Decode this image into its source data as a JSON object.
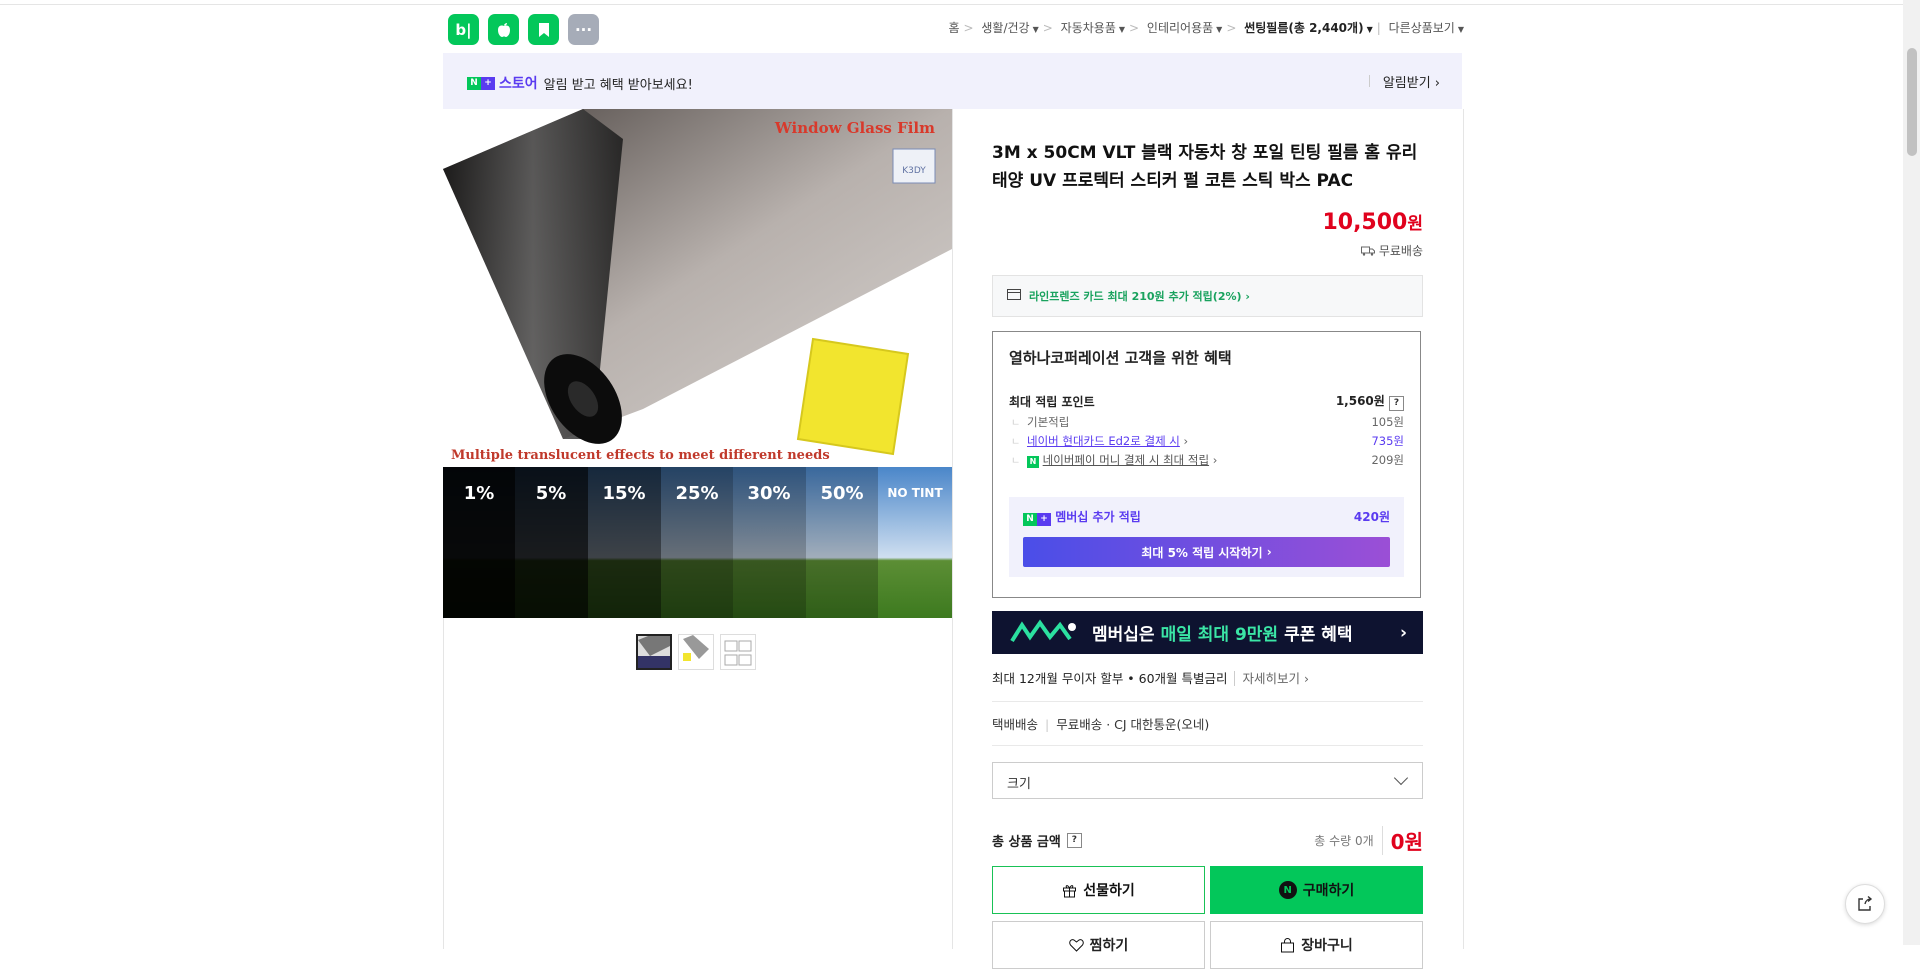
{
  "header": {
    "apps": [
      {
        "label": "b|",
        "icon": "blog-icon",
        "color": "#03c75a"
      },
      {
        "label": "",
        "icon": "apple-icon",
        "color": "#03c75a"
      },
      {
        "label": "",
        "icon": "bookmark-icon",
        "color": "#03c75a"
      },
      {
        "label": "···",
        "icon": "more-icon",
        "color": "#a6acb8"
      }
    ],
    "breadcrumb": {
      "home": "홈",
      "c1": "생활/건강",
      "c2": "자동차용품",
      "c3": "인테리어용품",
      "current": "썬팅필름(총 2,440개)",
      "other": "다른상품보기"
    }
  },
  "banner": {
    "store": "스토어",
    "text": "알림 받고 혜택 받아보세요!",
    "action": "알림받기"
  },
  "image": {
    "top_caption": "Window Glass Film",
    "brand": "K3DY",
    "bottom_caption": "Multiple translucent effects to meet different needs",
    "tints": [
      "1%",
      "5%",
      "15%",
      "25%",
      "30%",
      "50%",
      "NO TINT"
    ]
  },
  "product": {
    "title": "3M x 50CM VLT 블랙 자동차 창 포일 틴팅 필름 홈 유리 태양 UV 프로텍터 스티커 펄 코튼 스틱 박스 PAC",
    "price": "10,500",
    "currency": "원",
    "shipping": "무료배송"
  },
  "card_offer": "라인프렌즈 카드 최대 210원 추가 적립(2%)",
  "benefit": {
    "heading": "열하나코퍼레이션 고객을 위한 혜택",
    "max_label": "최대 적립 포인트",
    "max_value": "1,560원",
    "rows": [
      {
        "label": "기본적립",
        "value": "105원"
      },
      {
        "label": "네이버 현대카드 Ed2로 결제 시",
        "value": "735원"
      },
      {
        "label": "네이버페이 머니 결제 시 최대 적립",
        "value": "209원"
      }
    ],
    "membership_label": "멤버십 추가 적립",
    "membership_value": "420원",
    "membership_button": "최대 5% 적립 시작하기"
  },
  "promo": {
    "prefix": "멤버십은",
    "highlight": "매일 최대 9만원",
    "suffix": "쿠폰 혜택"
  },
  "installment": {
    "text": "최대 12개월 무이자 할부 • 60개월 특별금리",
    "more": "자세히보기"
  },
  "delivery": {
    "type": "택배배송",
    "fee": "무료배송",
    "courier": "CJ 대한통운(오네)"
  },
  "option": {
    "label": "크기"
  },
  "total": {
    "label": "총 상품 금액",
    "qty": "총 수량 0개",
    "amount": "0원"
  },
  "buttons": {
    "gift": "선물하기",
    "buy": "구매하기",
    "zzim": "찜하기",
    "cart": "장바구니"
  },
  "colors": {
    "accent_green": "#03c75a",
    "price_red": "#e0021d",
    "naver_purple": "#5a3bf0"
  }
}
